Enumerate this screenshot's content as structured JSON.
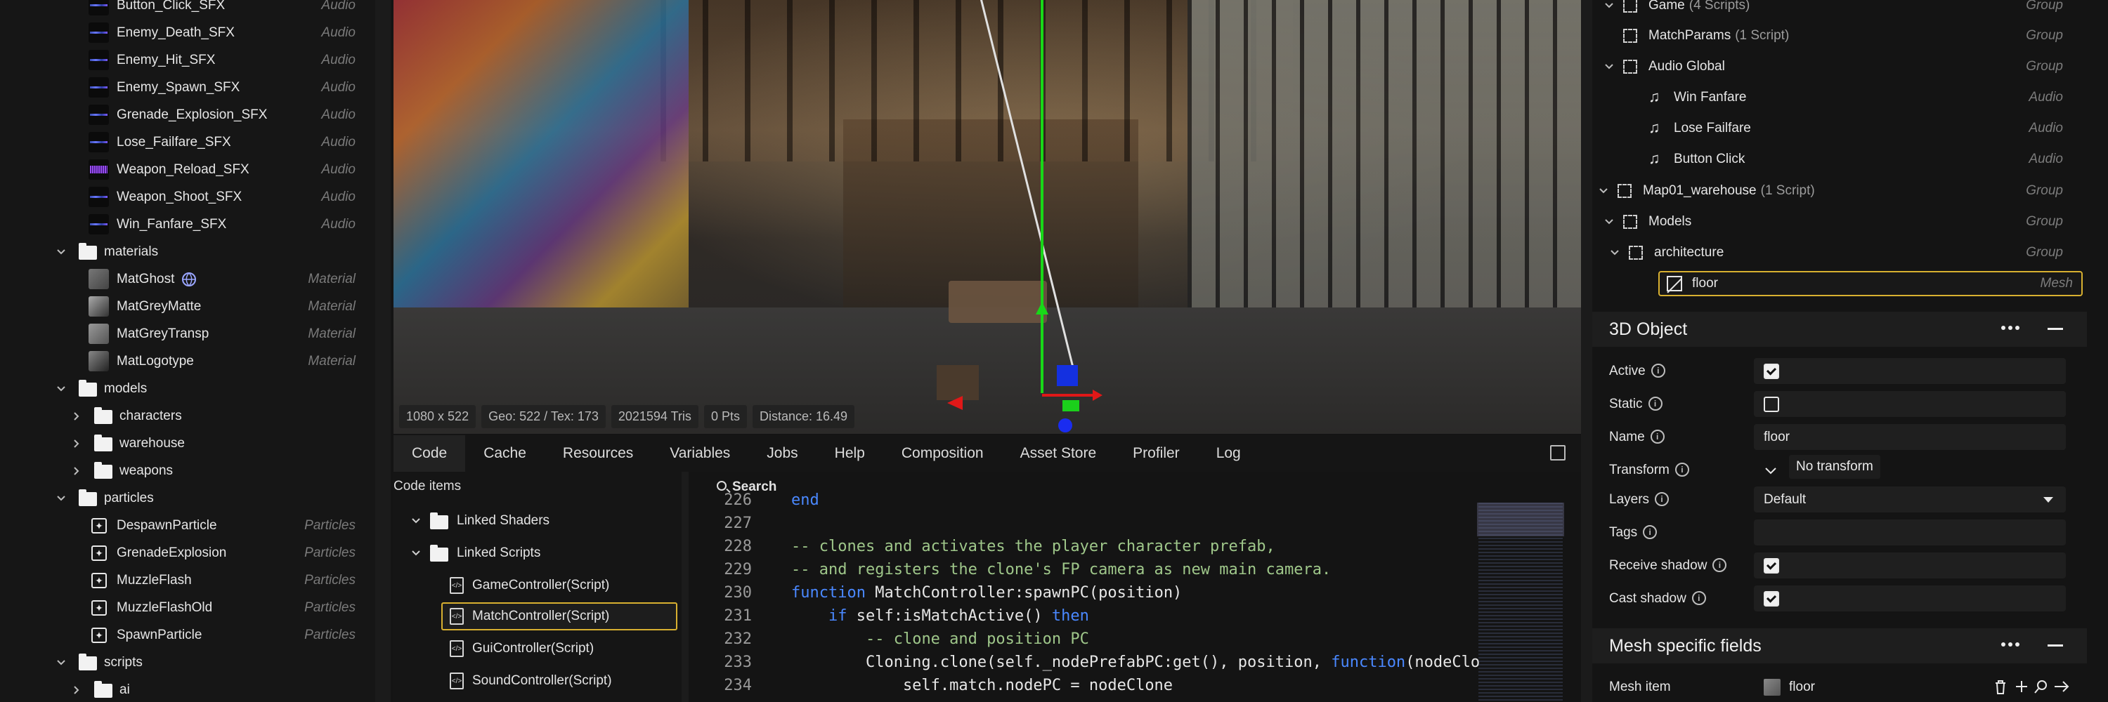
{
  "assets": {
    "audio": [
      {
        "label": "Button_Click_SFX",
        "type": "Audio"
      },
      {
        "label": "Enemy_Death_SFX",
        "type": "Audio"
      },
      {
        "label": "Enemy_Hit_SFX",
        "type": "Audio"
      },
      {
        "label": "Enemy_Spawn_SFX",
        "type": "Audio"
      },
      {
        "label": "Grenade_Explosion_SFX",
        "type": "Audio"
      },
      {
        "label": "Lose_Failfare_SFX",
        "type": "Audio"
      },
      {
        "label": "Weapon_Reload_SFX",
        "type": "Audio"
      },
      {
        "label": "Weapon_Shoot_SFX",
        "type": "Audio"
      },
      {
        "label": "Win_Fanfare_SFX",
        "type": "Audio"
      }
    ],
    "materials_folder": "materials",
    "materials": [
      {
        "label": "MatGhost",
        "type": "Material"
      },
      {
        "label": "MatGreyMatte",
        "type": "Material"
      },
      {
        "label": "MatGreyTransp",
        "type": "Material"
      },
      {
        "label": "MatLogotype",
        "type": "Material"
      }
    ],
    "models_folder": "models",
    "model_folders": [
      "characters",
      "warehouse",
      "weapons"
    ],
    "particles_folder": "particles",
    "particles": [
      {
        "label": "DespawnParticle",
        "type": "Particles"
      },
      {
        "label": "GrenadeExplosion",
        "type": "Particles"
      },
      {
        "label": "MuzzleFlash",
        "type": "Particles"
      },
      {
        "label": "MuzzleFlashOld",
        "type": "Particles"
      },
      {
        "label": "SpawnParticle",
        "type": "Particles"
      }
    ],
    "scripts_folder": "scripts",
    "script_folders": [
      "ai"
    ]
  },
  "viewport": {
    "stats": [
      "1080 x 522",
      "Geo: 522 / Tex: 173",
      "2021594 Tris",
      "0 Pts",
      "Distance: 16.49"
    ]
  },
  "tabs": [
    "Code",
    "Cache",
    "Resources",
    "Variables",
    "Jobs",
    "Help",
    "Composition",
    "Asset Store",
    "Profiler",
    "Log"
  ],
  "code_items": {
    "title": "Code items",
    "groups": [
      "Linked Shaders",
      "Linked Scripts"
    ],
    "scripts": [
      "GameController(Script)",
      "MatchController(Script)",
      "GuiController(Script)",
      "SoundController(Script)"
    ]
  },
  "editor": {
    "search_label": "Search",
    "lines": [
      {
        "n": "226",
        "parts": [
          {
            "t": "end",
            "c": "kw"
          }
        ]
      },
      {
        "n": "227",
        "parts": []
      },
      {
        "n": "228",
        "parts": [
          {
            "t": "-- clones and activates the player character prefab,",
            "c": "cm"
          }
        ]
      },
      {
        "n": "229",
        "parts": [
          {
            "t": "-- and registers the clone's FP camera as new main camera.",
            "c": "cm"
          }
        ]
      },
      {
        "n": "230",
        "parts": [
          {
            "t": "function",
            "c": "kw"
          },
          {
            "t": " MatchController:spawnPC(position)",
            "c": ""
          }
        ]
      },
      {
        "n": "231",
        "parts": [
          {
            "t": "    ",
            "c": ""
          },
          {
            "t": "if",
            "c": "kw"
          },
          {
            "t": " self:isMatchActive() ",
            "c": ""
          },
          {
            "t": "then",
            "c": "kw"
          }
        ]
      },
      {
        "n": "232",
        "parts": [
          {
            "t": "        ",
            "c": ""
          },
          {
            "t": "-- clone and position PC",
            "c": "cm"
          }
        ]
      },
      {
        "n": "233",
        "parts": [
          {
            "t": "        Cloning.clone(self._nodePrefabPC:get(), position, ",
            "c": ""
          },
          {
            "t": "function",
            "c": "kw"
          },
          {
            "t": "(nodeClo",
            "c": ""
          }
        ]
      },
      {
        "n": "234",
        "parts": [
          {
            "t": "            self.match.nodePC = nodeClone",
            "c": ""
          }
        ]
      }
    ]
  },
  "hierarchy": [
    {
      "label": "Game",
      "sub": "(4 Scripts)",
      "type": "Group",
      "icon": "group"
    },
    {
      "label": "MatchParams",
      "sub": "(1 Script)",
      "type": "Group",
      "icon": "group"
    },
    {
      "label": "Audio Global",
      "sub": "",
      "type": "Group",
      "icon": "group"
    },
    {
      "label": "Win Fanfare",
      "sub": "",
      "type": "Audio",
      "icon": "note"
    },
    {
      "label": "Lose Failfare",
      "sub": "",
      "type": "Audio",
      "icon": "note"
    },
    {
      "label": "Button Click",
      "sub": "",
      "type": "Audio",
      "icon": "note"
    },
    {
      "label": "Map01_warehouse",
      "sub": "(1 Script)",
      "type": "Group",
      "icon": "group"
    },
    {
      "label": "Models",
      "sub": "",
      "type": "Group",
      "icon": "group"
    },
    {
      "label": "architecture",
      "sub": "",
      "type": "Group",
      "icon": "group"
    },
    {
      "label": "floor",
      "sub": "",
      "type": "Mesh",
      "icon": "mesh"
    }
  ],
  "object_panel": {
    "title": "3D Object",
    "props": {
      "active": "Active",
      "static": "Static",
      "name": "Name",
      "name_value": "floor",
      "transform": "Transform",
      "transform_tooltip": "No transform",
      "layers": "Layers",
      "layers_value": "Default",
      "tags": "Tags",
      "receive_shadow": "Receive shadow",
      "cast_shadow": "Cast shadow"
    }
  },
  "mesh_panel": {
    "title": "Mesh specific fields",
    "mesh_item_label": "Mesh item",
    "mesh_item_value": "floor"
  }
}
